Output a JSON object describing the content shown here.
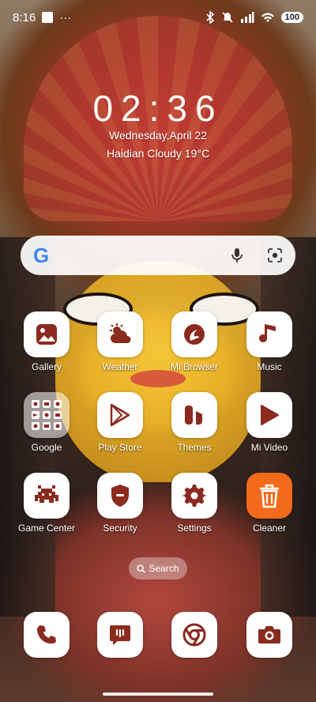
{
  "status_bar": {
    "time": "8:16",
    "more": "···",
    "battery": "100"
  },
  "clock_widget": {
    "time": "02:36",
    "date": "Wednesday,April 22",
    "weather": "Haidian Cloudy 19°C"
  },
  "search_bar": {
    "logo_letter": "G"
  },
  "apps": [
    {
      "label": "Gallery",
      "icon": "gallery-icon"
    },
    {
      "label": "Weather",
      "icon": "weather-icon"
    },
    {
      "label": "Mi Browser",
      "icon": "browser-icon"
    },
    {
      "label": "Music",
      "icon": "music-icon"
    },
    {
      "label": "Google",
      "icon": "google-folder-icon"
    },
    {
      "label": "Play Store",
      "icon": "play-store-icon"
    },
    {
      "label": "Themes",
      "icon": "themes-icon"
    },
    {
      "label": "Mi Video",
      "icon": "video-icon"
    },
    {
      "label": "Game Center",
      "icon": "game-center-icon"
    },
    {
      "label": "Security",
      "icon": "security-icon"
    },
    {
      "label": "Settings",
      "icon": "settings-icon"
    },
    {
      "label": "Cleaner",
      "icon": "cleaner-icon"
    }
  ],
  "home_search": {
    "label": "Search"
  },
  "dock": [
    {
      "icon": "phone-icon"
    },
    {
      "icon": "messages-icon"
    },
    {
      "icon": "chrome-icon"
    },
    {
      "icon": "camera-icon"
    }
  ],
  "colors": {
    "icon_glyph": "#8B2A1E",
    "cleaner_bg": "#F26A1B"
  }
}
